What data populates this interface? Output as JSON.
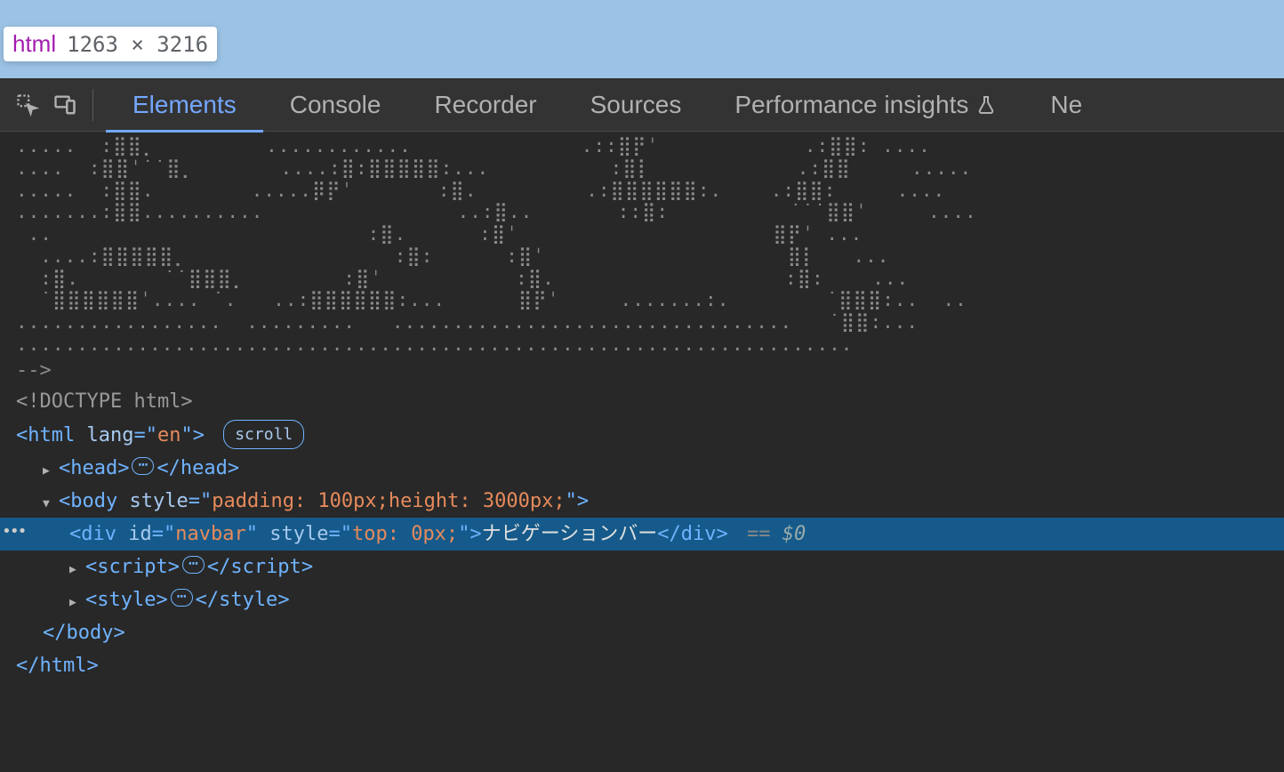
{
  "tooltip": {
    "tag": "html",
    "dimensions": "1263 × 3216"
  },
  "tabs": {
    "elements": "Elements",
    "console": "Console",
    "recorder": "Recorder",
    "sources": "Sources",
    "performance": "Performance insights",
    "next": "Ne"
  },
  "dom": {
    "ascii_art": ".....  :⣿⣿⡀         ............              .::⣿⡟ˈ            .:⣿⣿: ....\n....  :⣿⣿ˈ˙˙⣿⡀       ....:⣿:⣿⣿⣿⣿⣿:...          :⣿⡇            .:⣿⣿     .....\n.....  :⣿⣿.        .....⡿⡟ˈ       :⣿.         .:⣿⣿⣿⣿⣿⣿:.    .:⣿⣿:     ....\n.......:⣿⣿..........                ..:⣿..       ::⣿:          ˙˙˙⣿⣿ˈ     ....\n ..                          :⣿.      :⣿ˈ                     ⣿⡟ˈ ...\n  ....:⣿⣿⣿⣿⣿⡀                 :⣿:      :⣿ˈ                    ⣿⡇   ...\n  :⣿.       ˙˙⣿⣿⣿⡀        :⣿ˈ           :⣿.                   :⣿:    ...\n  ˙⣿⣿⣿⣿⣿⣿ˈ.... ˙.   ..:⣿⣿⣿⣿⣿⣿:...      ⣿⡟ˈ     .......:.        ˙⣿⣿⣿:..  ..\n.................  .........   .................................   ˙⣿⣿:...\n.....................................................................\n",
    "comment_close": "-->",
    "doctype": "<!DOCTYPE html>",
    "html_open_tag": "html",
    "html_attr_lang_name": "lang",
    "html_attr_lang_val": "en",
    "scroll_badge": "scroll",
    "head_tag": "head",
    "body_tag": "body",
    "body_attr_style_name": "style",
    "body_attr_style_val": "padding: 100px;height: 3000px;",
    "div_tag": "div",
    "div_attr_id_name": "id",
    "div_attr_id_val": "navbar",
    "div_attr_style_name": "style",
    "div_attr_style_val": "top: 0px;",
    "div_text": "ナビゲーションバー",
    "eq0": "== $0",
    "script_tag": "script",
    "style_tag": "style",
    "body_close": "body",
    "html_close": "html"
  }
}
